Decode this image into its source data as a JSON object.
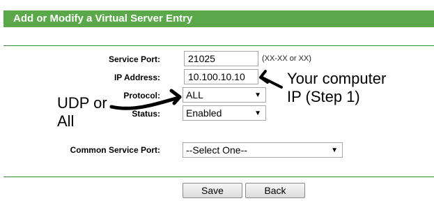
{
  "header": {
    "title": "Add or Modify a Virtual Server Entry"
  },
  "form": {
    "service_port": {
      "label": "Service Port:",
      "value": "21025",
      "hint": "(XX-XX or XX)"
    },
    "ip_address": {
      "label": "IP Address:",
      "value": "10.100.10.10"
    },
    "protocol": {
      "label": "Protocol:",
      "value": "ALL"
    },
    "status": {
      "label": "Status:",
      "value": "Enabled"
    },
    "common_service_port": {
      "label": "Common Service Port:",
      "value": "--Select One--"
    }
  },
  "buttons": {
    "save": "Save",
    "back": "Back"
  },
  "annotations": {
    "ip_note_line1": "Your computer",
    "ip_note_line2": "IP (Step 1)",
    "protocol_note_line1": "UDP or",
    "protocol_note_line2": "All"
  },
  "colors": {
    "header_bg": "#5aa84a",
    "rule": "#3a8f3a"
  }
}
